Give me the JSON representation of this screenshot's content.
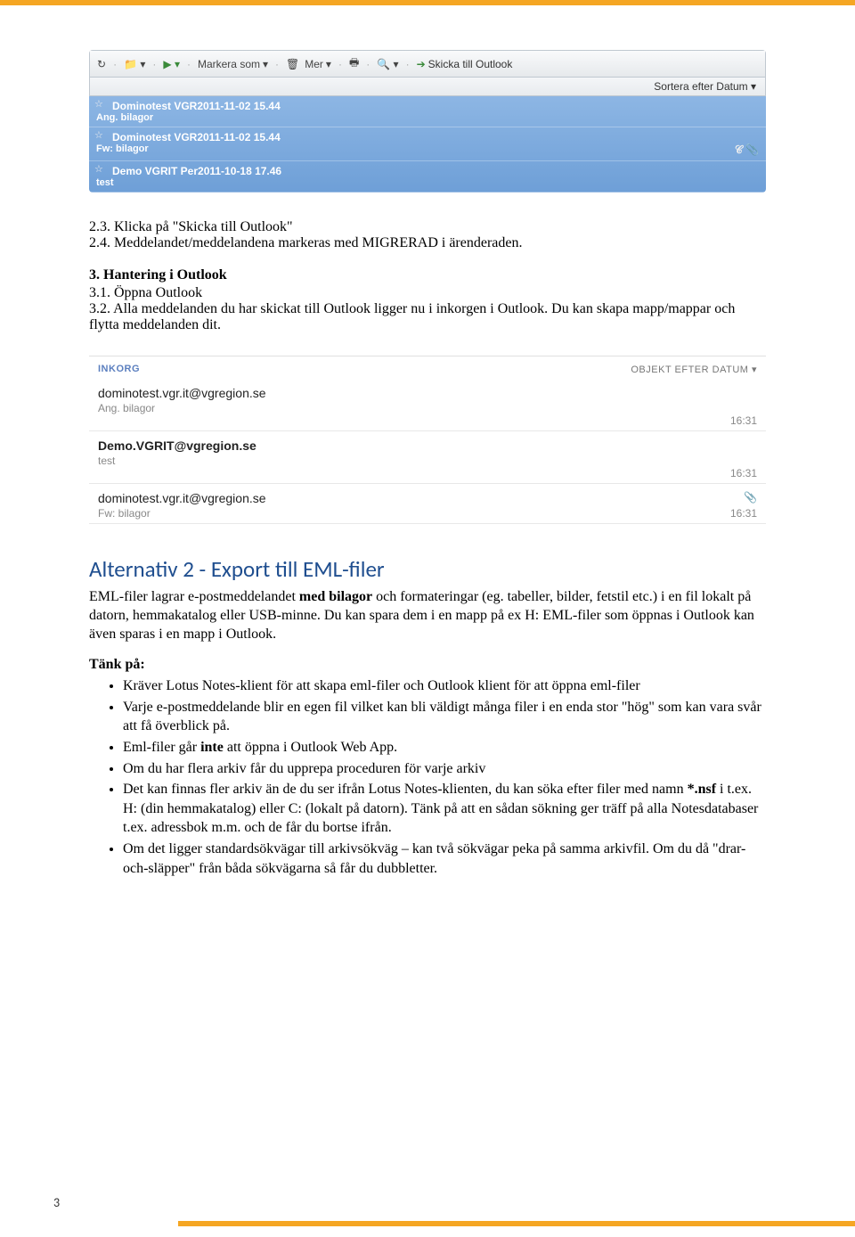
{
  "screenshot1": {
    "toolbar": {
      "markera": "Markera som",
      "mer": "Mer",
      "skicka": "Skicka till Outlook"
    },
    "sortbar": "Sortera efter Datum",
    "messages": [
      {
        "from": "Dominotest VGR2011-11-02 15.44",
        "subject": "Ang. bilagor"
      },
      {
        "from": "Dominotest VGR2011-11-02 15.44",
        "subject": "Fw: bilagor"
      },
      {
        "from": "Demo VGRIT Per2011-10-18 17.46",
        "subject": "test"
      }
    ]
  },
  "section23": "2.3. Klicka på \"Skicka till Outlook\"",
  "section24": "2.4. Meddelandet/meddelandena markeras med MIGRERAD i ärenderaden.",
  "h3": "3. Hantering i Outlook",
  "section31": "3.1. Öppna Outlook",
  "section32": "3.2. Alla meddelanden du har skickat till Outlook ligger nu i inkorgen i Outlook. Du kan skapa mapp/mappar och flytta meddelanden dit.",
  "inbox": {
    "headLeft": "INKORG",
    "headRight": "OBJEKT EFTER DATUM",
    "rows": [
      {
        "from": "dominotest.vgr.it@vgregion.se",
        "subject": "Ang. bilagor",
        "time": "16:31",
        "clip": false
      },
      {
        "from": "Demo.VGRIT@vgregion.se",
        "subject": "test",
        "time": "16:31",
        "clip": false
      },
      {
        "from": "dominotest.vgr.it@vgregion.se",
        "subject": "Fw: bilagor",
        "time": "16:31",
        "clip": true
      }
    ]
  },
  "altHeading": "Alternativ 2 - Export till EML-filer",
  "altP1a": "EML-filer lagrar e-postmeddelandet ",
  "altP1bold": "med bilagor",
  "altP1b": " och formateringar (eg. tabeller, bilder, fetstil etc.) i en fil lokalt på datorn, hemmakatalog eller USB-minne. Du kan spara dem i en mapp på ex H: EML-filer som öppnas i Outlook kan även sparas i en mapp i Outlook.",
  "tank": "Tänk på:",
  "bullets": {
    "b1": "Kräver Lotus Notes-klient för att skapa eml-filer och Outlook klient för att öppna eml-filer",
    "b2": "Varje e-postmeddelande blir en egen fil vilket kan bli väldigt många filer i en enda stor \"hög\" som kan vara svår att få överblick på.",
    "b3a": "Eml-filer går ",
    "b3bold": "inte",
    "b3b": " att öppna i Outlook Web App.",
    "b4": "Om du har flera arkiv får du upprepa proceduren för varje arkiv",
    "b5a": "Det kan finnas fler arkiv än de du ser ifrån Lotus Notes-klienten, du kan söka efter filer med namn ",
    "b5bold": "*.nsf",
    "b5b": " i t.ex. H: (din hemmakatalog) eller C: (lokalt på datorn). Tänk på att en sådan sökning ger träff på alla Notesdatabaser t.ex. adressbok m.m. och de får du bortse ifrån.",
    "b6": "Om det ligger standardsökvägar till arkivsökväg – kan två sökvägar peka på samma arkivfil. Om du då \"drar-och-släpper\" från båda sökvägarna så får du dubbletter."
  },
  "pageNum": "3"
}
